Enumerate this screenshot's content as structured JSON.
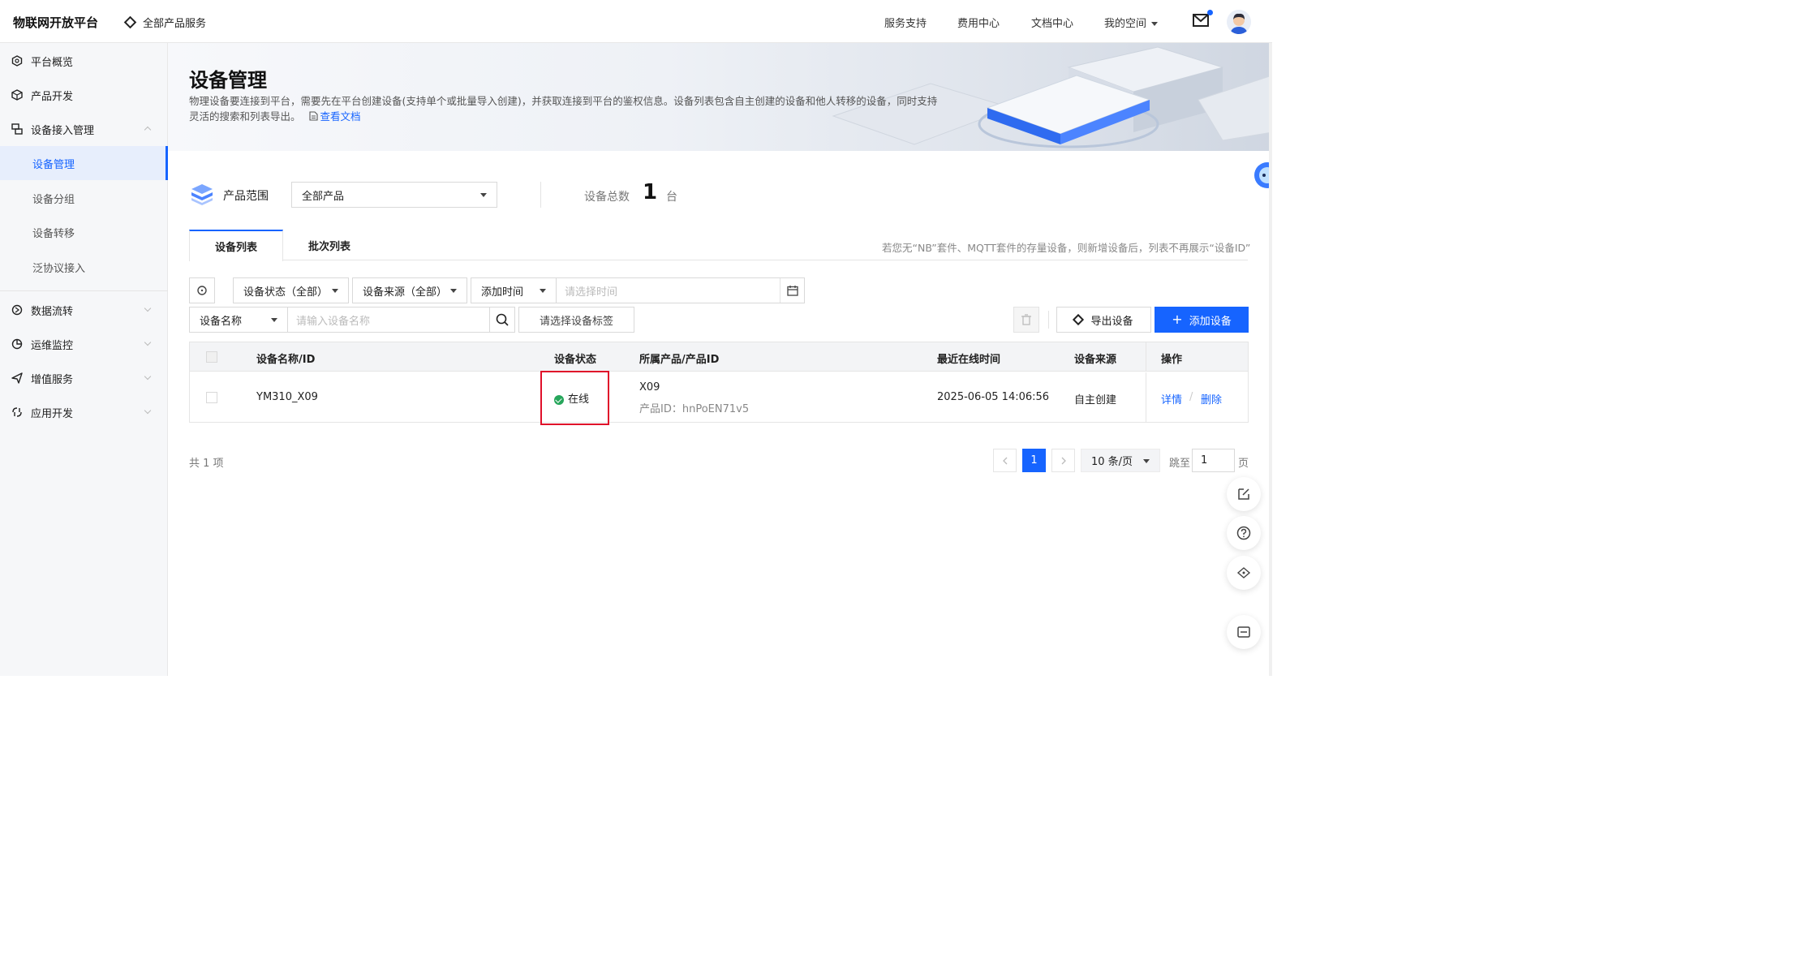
{
  "topnav": {
    "brand": "物联网开放平台",
    "all_products": "全部产品服务",
    "links": [
      "服务支持",
      "费用中心",
      "文档中心",
      "我的空间"
    ]
  },
  "sidebar": {
    "items": [
      {
        "label": "平台概览",
        "icon": "hexagon-icon"
      },
      {
        "label": "产品开发",
        "icon": "cube-icon"
      },
      {
        "label": "设备接入管理",
        "icon": "device-icon",
        "expanded": true
      },
      {
        "label": "数据流转",
        "icon": "flow-icon"
      },
      {
        "label": "运维监控",
        "icon": "monitor-icon"
      },
      {
        "label": "增值服务",
        "icon": "send-icon"
      },
      {
        "label": "应用开发",
        "icon": "app-icon"
      }
    ],
    "sub_items": [
      "设备管理",
      "设备分组",
      "设备转移",
      "泛协议接入"
    ],
    "active_sub": "设备管理"
  },
  "banner": {
    "title": "设备管理",
    "desc": "物理设备要连接到平台，需要先在平台创建设备(支持单个或批量导入创建)，并获取连接到平台的鉴权信息。设备列表包含自主创建的设备和他人转移的设备，同时支持灵活的搜索和列表导出。",
    "doc_link": "查看文档"
  },
  "summary": {
    "scope_label": "产品范围",
    "scope_value": "全部产品",
    "total_label": "设备总数",
    "total_value": "1",
    "total_unit": "台"
  },
  "tabs": [
    "设备列表",
    "批次列表"
  ],
  "tabs_note": "若您无“NB”套件、MQTT套件的存量设备，则新增设备后，列表不再展示“设备ID”",
  "filters": {
    "status": "设备状态（全部）",
    "source": "设备来源（全部）",
    "time_type": "添加时间",
    "time_placeholder": "请选择时间",
    "name_type": "设备名称",
    "name_placeholder": "请输入设备名称",
    "tag_placeholder": "请选择设备标签",
    "export": "导出设备",
    "add": "添加设备"
  },
  "table": {
    "headers": [
      "设备名称/ID",
      "设备状态",
      "所属产品/产品ID",
      "最近在线时间",
      "设备来源",
      "操作"
    ],
    "rows": [
      {
        "name": "YM310_X09",
        "status": "在线",
        "product": "X09",
        "product_id": "产品ID：hnPoEN71v5",
        "last_online": "2025-06-05 14:06:56",
        "source": "自主创建",
        "detail": "详情",
        "sep": "/",
        "delete": "删除"
      }
    ]
  },
  "pagination": {
    "total": "共 1 项",
    "current": "1",
    "page_size": "10 条/页",
    "jump_label": "跳至",
    "jump_value": "1",
    "page_unit": "页"
  },
  "colors": {
    "primary": "#1664ff",
    "online": "#26a65b",
    "highlight": "#e0102a"
  }
}
